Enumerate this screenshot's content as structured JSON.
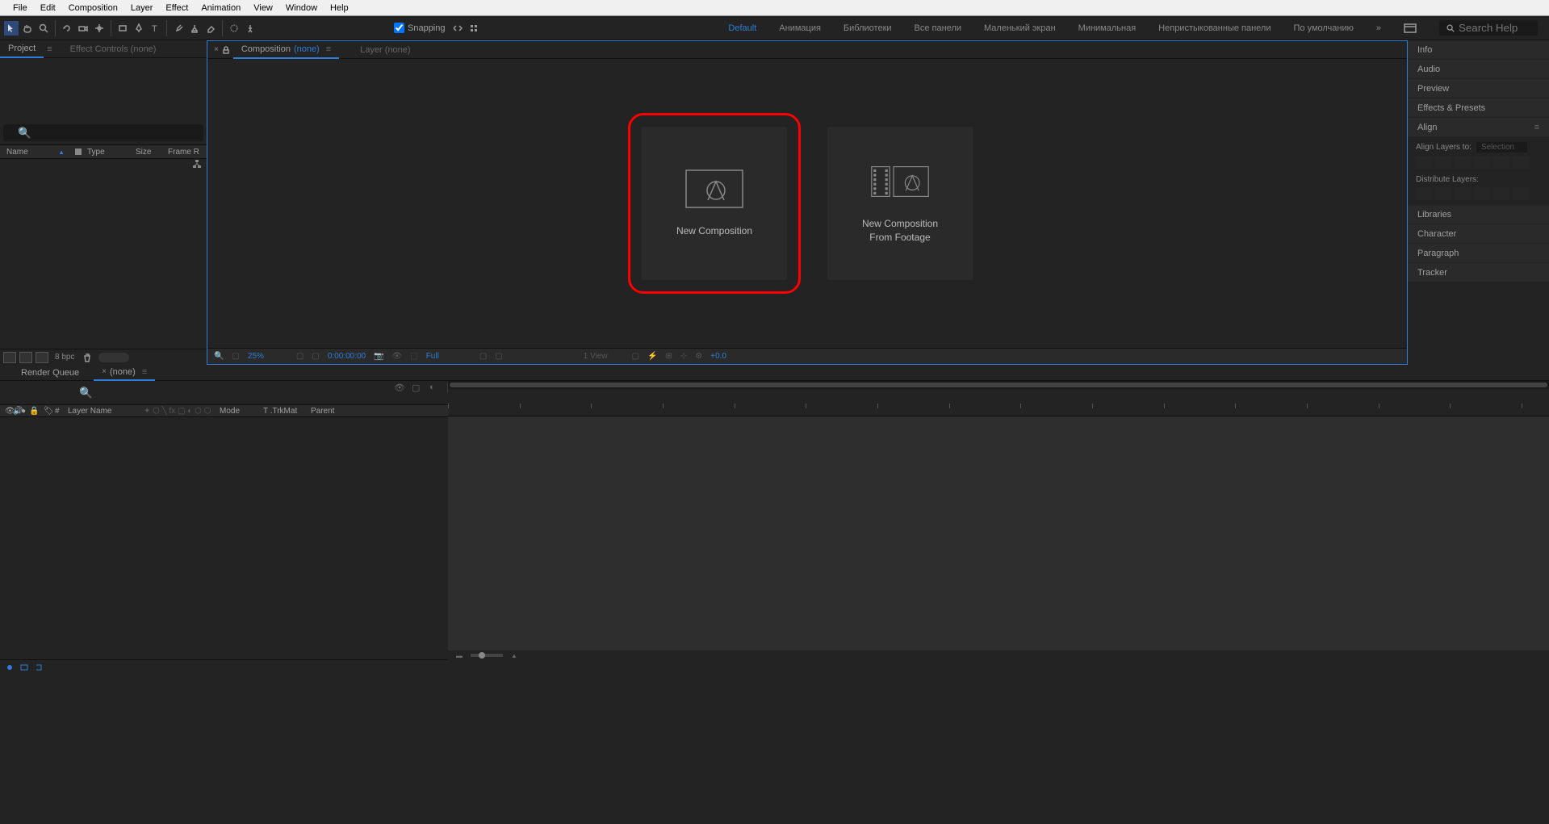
{
  "menu": {
    "file": "File",
    "edit": "Edit",
    "composition": "Composition",
    "layer": "Layer",
    "effect": "Effect",
    "animation": "Animation",
    "view": "View",
    "window": "Window",
    "help": "Help"
  },
  "toolbar": {
    "snapping": "Snapping"
  },
  "workspaces": {
    "default": "Default",
    "animation": "Анимация",
    "libraries": "Библиотеки",
    "allpanels": "Все панели",
    "smallscreen": "Маленький экран",
    "minimal": "Минимальная",
    "undocked": "Непристыкованные панели",
    "bydefault": "По умолчанию",
    "search_placeholder": "Search Help"
  },
  "left": {
    "project": "Project",
    "effect_controls": "Effect Controls (none)",
    "header_name": "Name",
    "header_type": "Type",
    "header_size": "Size",
    "header_frame": "Frame R",
    "bpc": "8 bpc"
  },
  "comp": {
    "tab_composition": "Composition",
    "tab_none": "(none)",
    "tab_layer": "Layer (none)"
  },
  "cards": {
    "new_comp": "New Composition",
    "new_comp_footage": "New Composition\nFrom Footage"
  },
  "viewer": {
    "zoom": "25%",
    "time": "0:00:00:00",
    "quality": "Full",
    "views": "1 View",
    "exposure": "+0.0"
  },
  "right": {
    "info": "Info",
    "audio": "Audio",
    "preview": "Preview",
    "effects_presets": "Effects & Presets",
    "align": "Align",
    "align_layers": "Align Layers to:",
    "align_selection": "Selection",
    "distribute": "Distribute Layers:",
    "libraries": "Libraries",
    "character": "Character",
    "paragraph": "Paragraph",
    "tracker": "Tracker"
  },
  "timeline": {
    "render_queue": "Render Queue",
    "none": "(none)",
    "layer_name": "Layer Name",
    "mode": "Mode",
    "trkmat": "T .TrkMat",
    "parent": "Parent",
    "num": "#"
  }
}
